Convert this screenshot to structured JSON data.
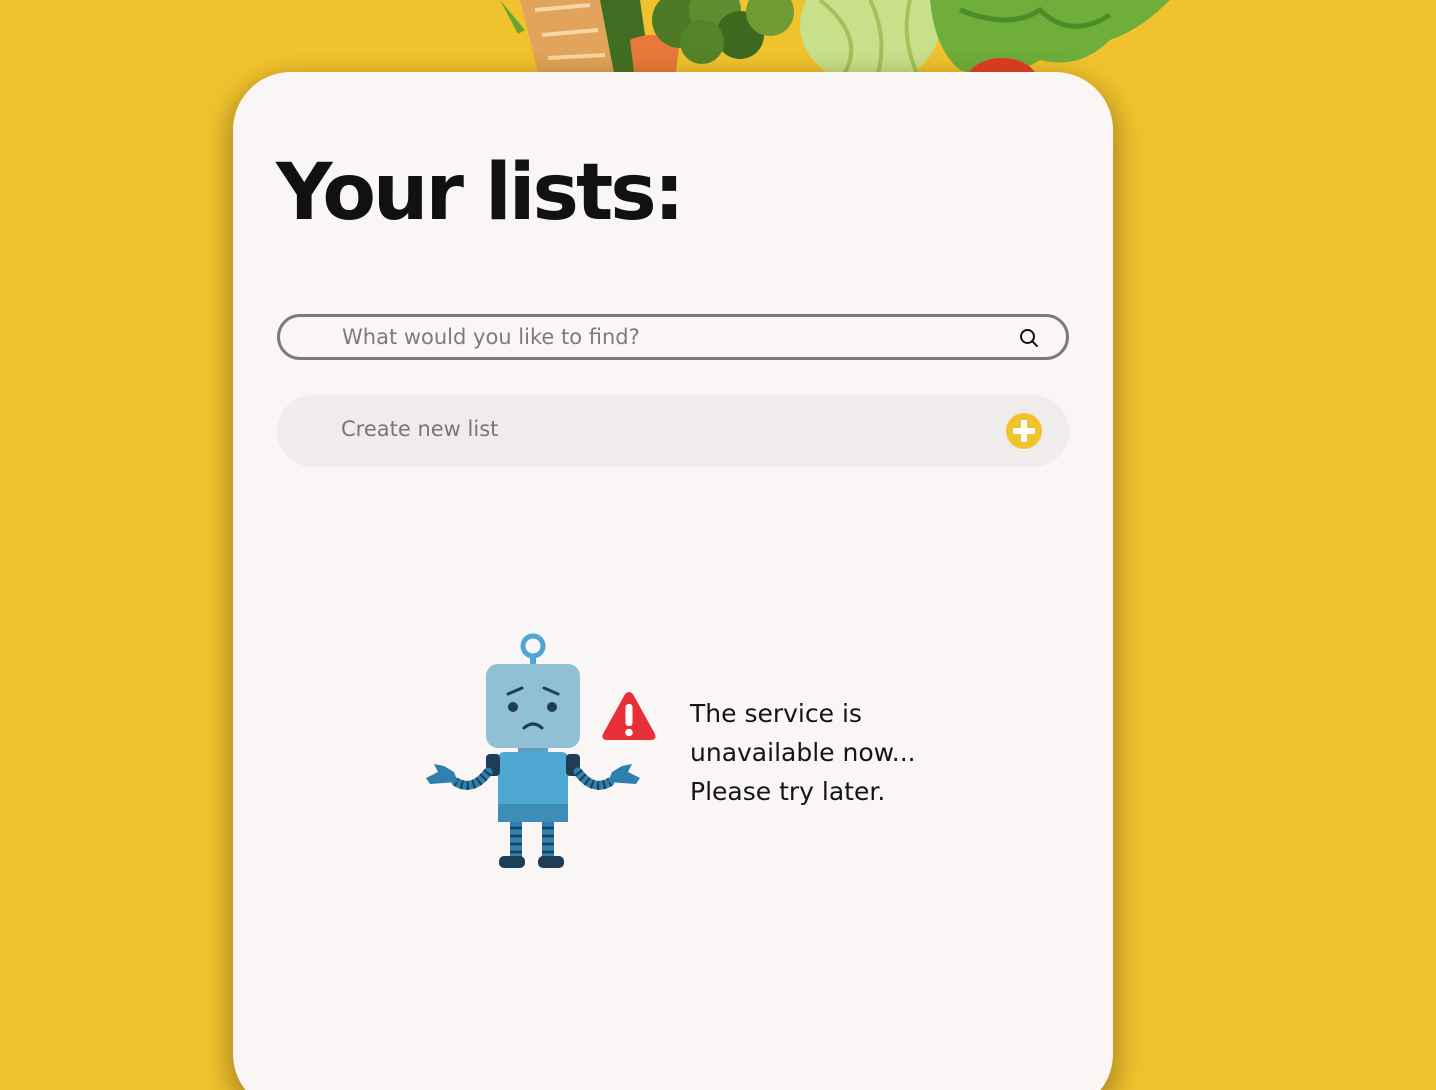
{
  "header": {
    "title": "Your lists:"
  },
  "search": {
    "placeholder": "What would you like to find?",
    "icon": "search-icon"
  },
  "create_list": {
    "label": "Create new list",
    "icon": "plus-circle-icon",
    "icon_color": "#F0C32E"
  },
  "error": {
    "lines": [
      "The service is",
      "unavailable now...",
      "Please try later."
    ],
    "illustration": "sad-robot-illustration",
    "icon": "warning-icon",
    "icon_color": "#E8303A"
  },
  "colors": {
    "background": "#F0C32E",
    "card": "#FBF6F6",
    "create_row_bg": "#F0ECEB"
  }
}
